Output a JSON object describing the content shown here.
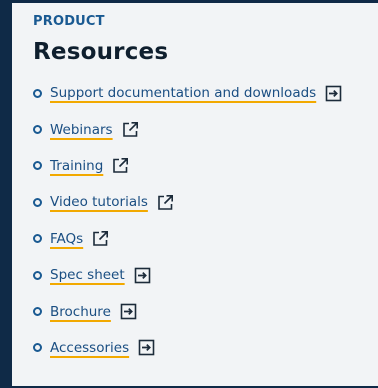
{
  "section": {
    "eyebrow": "PRODUCT",
    "title": "Resources"
  },
  "links": [
    {
      "label": "Support documentation and downloads",
      "icon": "arrow-into-box-icon"
    },
    {
      "label": "Webinars",
      "icon": "external-link-icon"
    },
    {
      "label": "Training",
      "icon": "external-link-icon"
    },
    {
      "label": "Video tutorials",
      "icon": "external-link-icon"
    },
    {
      "label": "FAQs",
      "icon": "external-link-icon"
    },
    {
      "label": "Spec sheet",
      "icon": "arrow-into-box-icon"
    },
    {
      "label": "Brochure",
      "icon": "arrow-into-box-icon"
    },
    {
      "label": "Accessories",
      "icon": "arrow-into-box-icon"
    }
  ],
  "colors": {
    "background": "#0f2a47",
    "panel": "#f2f4f6",
    "eyebrow": "#1a5a92",
    "link": "#1a4e82",
    "underline": "#f2a900"
  }
}
